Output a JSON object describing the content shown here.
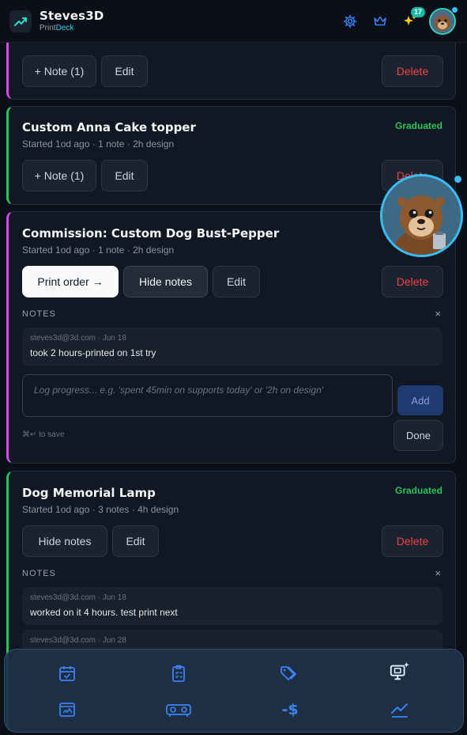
{
  "header": {
    "brand_name": "Steves3D",
    "brand_sub_a": "Print",
    "brand_sub_b": "Deck",
    "notification_count": "17",
    "icons": [
      "gear-icon",
      "crown-icon",
      "sparkles-icon"
    ]
  },
  "colors": {
    "accent": "#22d3ee",
    "graduated": "#22c55e",
    "delete": "#ef4444",
    "pink_stripe": "#d946ef"
  },
  "card0": {
    "note_button": "+ Note (1)",
    "edit": "Edit",
    "delete": "Delete"
  },
  "card1": {
    "title": "Custom Anna Cake topper",
    "meta": "Started 1od ago · 1 note · 2h design",
    "status": "Graduated",
    "note_button": "+ Note (1)",
    "edit": "Edit",
    "delete": "Delete"
  },
  "card2": {
    "title": "Commission: Custom Dog Bust-Pepper",
    "meta": "Started 1od ago · 1 note · 2h design",
    "print_order": "Print order →",
    "hide_notes": "Hide notes",
    "edit": "Edit",
    "delete": "Delete",
    "notes_label": "NOTES",
    "close": "×",
    "notes": [
      {
        "meta": "steves3d@3d.com · Jun 18",
        "text": "took 2 hours-printed on 1st try"
      }
    ],
    "placeholder": "Log progress... e.g. 'spent 45min on supports today' or '2h on design'",
    "add": "Add",
    "hint": "⌘↵ to save",
    "done": "Done"
  },
  "card3": {
    "title": "Dog Memorial Lamp",
    "meta": "Started 1od ago · 3 notes · 4h design",
    "status": "Graduated",
    "hide_notes": "Hide notes",
    "edit": "Edit",
    "delete": "Delete",
    "notes_label": "NOTES",
    "close": "×",
    "notes": [
      {
        "meta": "steves3d@3d.com · Jun 18",
        "text": "worked on it 4 hours. test print next"
      },
      {
        "meta": "steves3d@3d.com · Jun 28",
        "text": ""
      }
    ]
  },
  "dock": {
    "icons": [
      "calendar-check-icon",
      "clipboard-list-icon",
      "tags-icon",
      "ai-monitor-icon",
      "image-board-icon",
      "printer-icon",
      "minus-dollar-icon",
      "trend-chart-icon"
    ],
    "minus_dollar": "-$"
  }
}
